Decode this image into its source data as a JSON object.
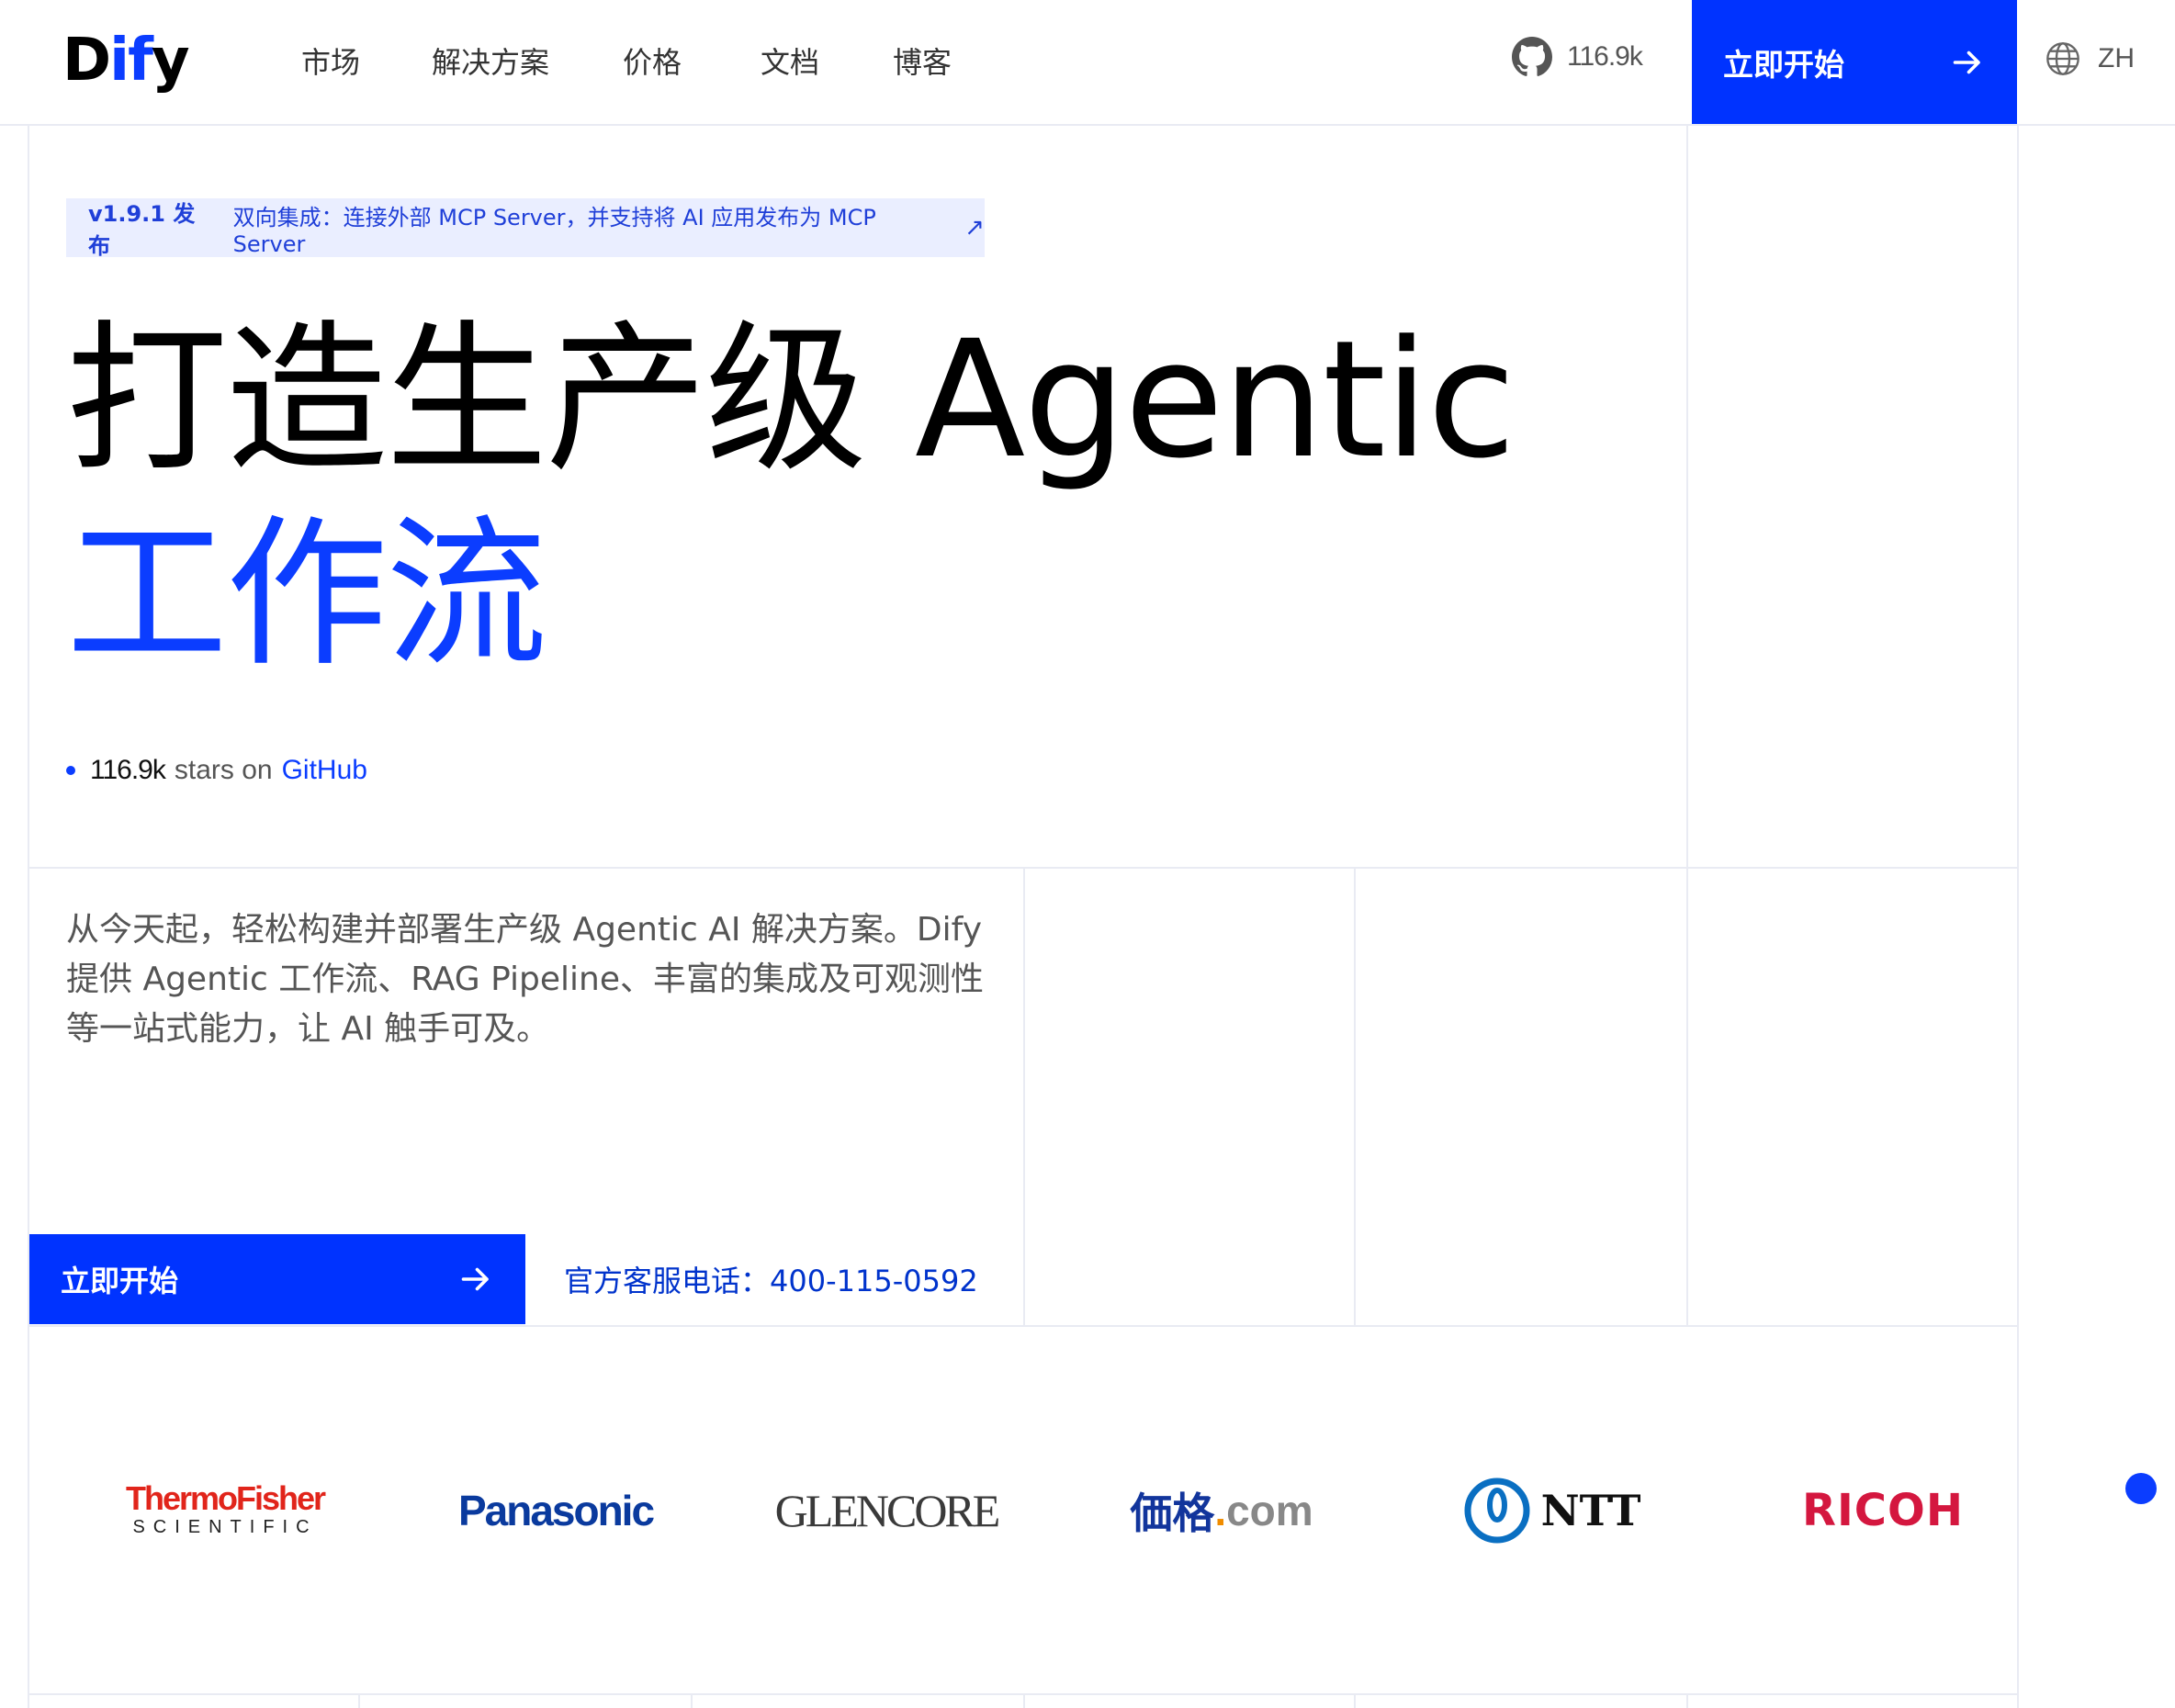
{
  "brand": {
    "name_prefix": "D",
    "name_accent": "if",
    "name_suffix": "y",
    "accent_color": "#0b3dff",
    "primary_button_color": "#0033ff"
  },
  "nav": {
    "items": [
      "市场",
      "解决方案",
      "价格",
      "文档",
      "博客"
    ]
  },
  "header": {
    "github_count": "116.9k",
    "cta_label": "立即开始",
    "language": "ZH"
  },
  "release": {
    "version": "v1.9.1 发布",
    "text": "双向集成：连接外部 MCP Server，并支持将 AI 应用发布为 MCP Server"
  },
  "hero": {
    "title_line1": "打造生产级 Agentic",
    "title_line2": "工作流",
    "stars_count": "116.9k",
    "stars_text": "stars on",
    "stars_link": "GitHub",
    "description": "从今天起，轻松构建并部署生产级 Agentic AI 解决方案。Dify 提供 Agentic 工作流、RAG Pipeline、丰富的集成及可观测性等一站式能力，让 AI 触手可及。",
    "cta_label": "立即开始",
    "phone_label": "官方客服电话：400-115-0592"
  },
  "logos": {
    "thermofisher_line1": "ThermoFisher",
    "thermofisher_line2": "SCIENTIFIC",
    "panasonic": "Panasonic",
    "glencore": "GLENCORE",
    "kakaku_main": "価格",
    "kakaku_dot": ".",
    "kakaku_com": "com",
    "ntt": "NTT",
    "ricoh": "RICOH"
  }
}
